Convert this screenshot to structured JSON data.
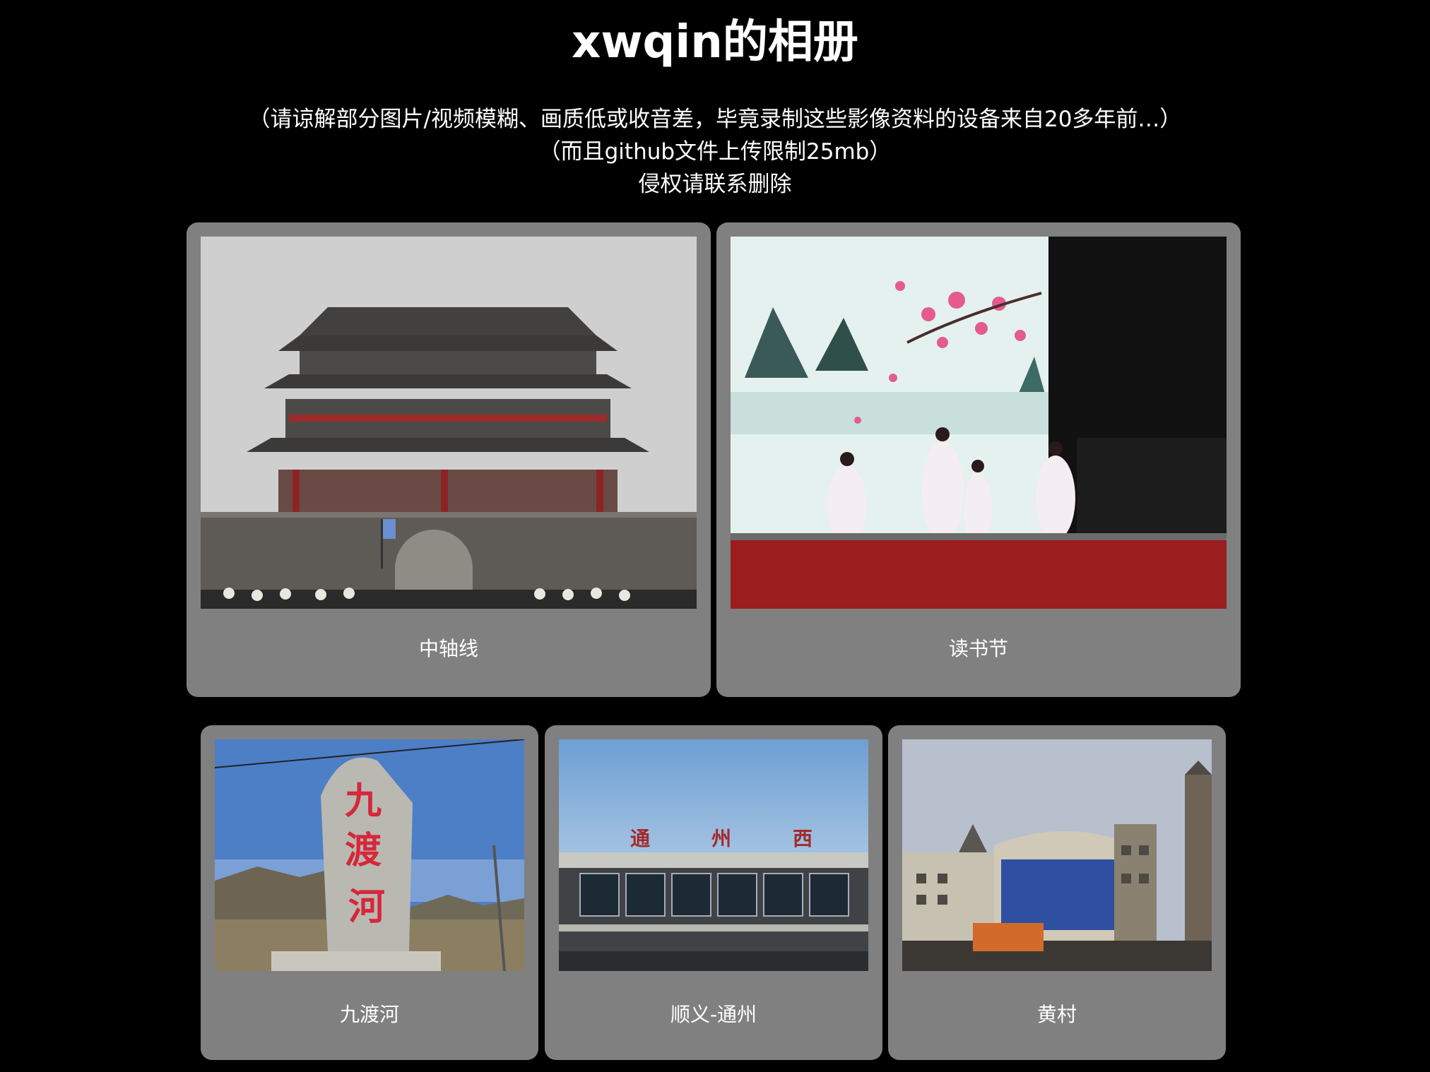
{
  "page": {
    "title": "xwqin的相册",
    "notes": [
      "（请谅解部分图片/视频模糊、画质低或收音差，毕竟录制这些影像资料的设备来自20多年前…）",
      "（而且github文件上传限制25mb）",
      "侵权请联系删除"
    ]
  },
  "albums": [
    {
      "caption": "中轴线",
      "photo": "gate-tower-photo"
    },
    {
      "caption": "读书节",
      "photo": "stage-dance-photo"
    },
    {
      "caption": "九渡河",
      "photo": "stone-monument-photo"
    },
    {
      "caption": "顺义-通州",
      "photo": "train-station-photo"
    },
    {
      "caption": "黄村",
      "photo": "town-building-photo"
    }
  ],
  "photo_text": {
    "station_sign": [
      "通",
      "州",
      "西"
    ],
    "monument_chars": [
      "九",
      "渡",
      "河"
    ]
  }
}
